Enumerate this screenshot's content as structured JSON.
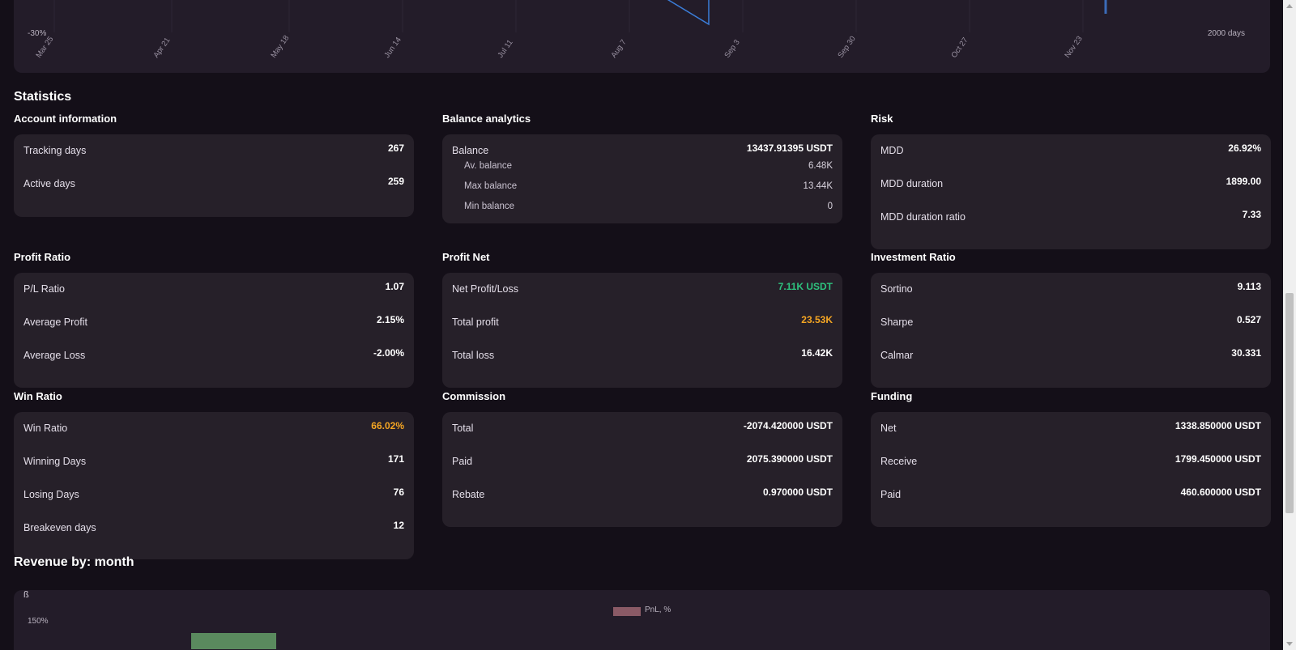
{
  "top_chart": {
    "y_min_label": "-30%",
    "right_label": "2000 days",
    "x_ticks": [
      "Mar 25",
      "Apr 21",
      "May 18",
      "Jun 14",
      "Jul 11",
      "Aug 7",
      "Sep 3",
      "Sep 30",
      "Oct 27",
      "Nov 23"
    ],
    "line_color": "#3b7dd8"
  },
  "statistics": {
    "title": "Statistics",
    "groups": [
      {
        "title": "Account information",
        "rows": [
          {
            "label": "Tracking days",
            "value": "267"
          },
          {
            "label": "Active days",
            "value": "259"
          }
        ]
      },
      {
        "title": "Balance analytics",
        "rows": [
          {
            "label": "Balance",
            "value": "13437.91395 USDT"
          },
          {
            "label": "Av. balance",
            "value": "6.48K"
          },
          {
            "label": "Max balance",
            "value": "13.44K"
          },
          {
            "label": "Min balance",
            "value": "0"
          }
        ]
      },
      {
        "title": "Risk",
        "rows": [
          {
            "label": "MDD",
            "value": "26.92%"
          },
          {
            "label": "MDD duration",
            "value": "1899.00"
          },
          {
            "label": "MDD duration ratio",
            "value": "7.33"
          }
        ]
      },
      {
        "title": "Profit Ratio",
        "rows": [
          {
            "label": "P/L Ratio",
            "value": "1.07"
          },
          {
            "label": "Average Profit",
            "value": "2.15%"
          },
          {
            "label": "Average Loss",
            "value": "-2.00%"
          }
        ]
      },
      {
        "title": "Profit Net",
        "rows": [
          {
            "label": "Net Profit/Loss",
            "value": "7.11K USDT"
          },
          {
            "label": "Total profit",
            "value": "23.53K"
          },
          {
            "label": "Total loss",
            "value": "16.42K"
          }
        ]
      },
      {
        "title": "Investment Ratio",
        "rows": [
          {
            "label": "Sortino",
            "value": "9.113"
          },
          {
            "label": "Sharpe",
            "value": "0.527"
          },
          {
            "label": "Calmar",
            "value": "30.331"
          }
        ]
      },
      {
        "title": "Win Ratio",
        "rows": [
          {
            "label": "Win Ratio",
            "value": "66.02%"
          },
          {
            "label": "Winning Days",
            "value": "171"
          },
          {
            "label": "Losing Days",
            "value": "76"
          },
          {
            "label": "Breakeven days",
            "value": "12"
          }
        ]
      },
      {
        "title": "Commission",
        "rows": [
          {
            "label": "Total",
            "value": "-2074.420000 USDT"
          },
          {
            "label": "Paid",
            "value": "2075.390000 USDT"
          },
          {
            "label": "Rebate",
            "value": "0.970000 USDT"
          }
        ]
      },
      {
        "title": "Funding",
        "rows": [
          {
            "label": "Net",
            "value": "1338.850000 USDT"
          },
          {
            "label": "Receive",
            "value": "1799.450000 USDT"
          },
          {
            "label": "Paid",
            "value": "460.600000 USDT"
          }
        ]
      }
    ]
  },
  "revenue": {
    "title": "Revenue by: month",
    "corner_label": "ß",
    "legend_label": "PnL, %",
    "y_top_label": "150%",
    "legend_color": "#8a5a66",
    "bar_color": "#5a8a5e"
  },
  "colors": {
    "positive": "#2ec27e",
    "highlight": "#f5a623"
  }
}
